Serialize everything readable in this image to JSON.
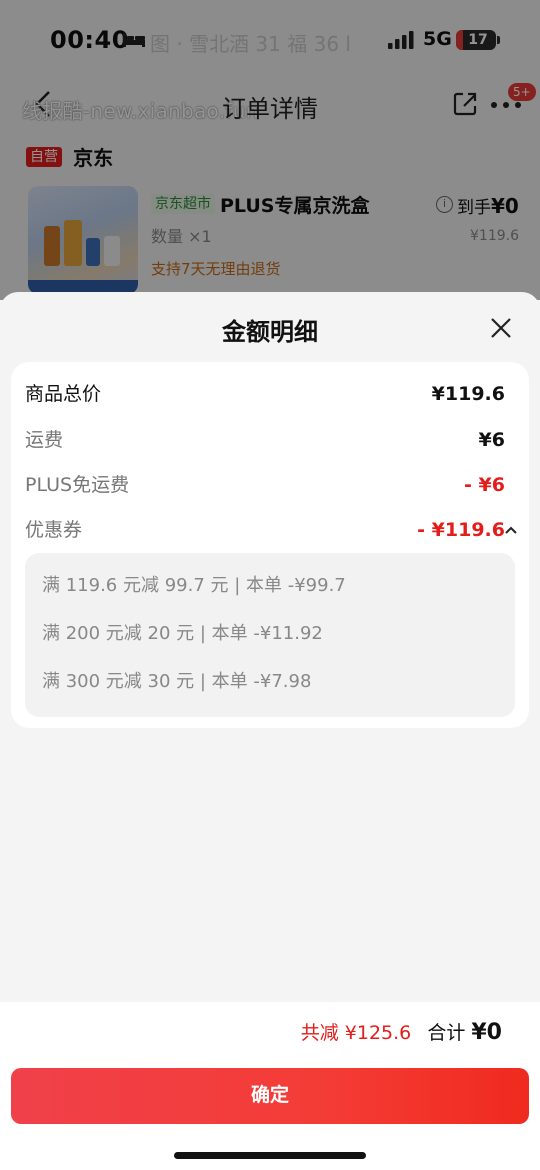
{
  "status_bar": {
    "time": "00:40",
    "faded_text": "图 · 雪北酒 31 福 36 l",
    "network": "5G",
    "battery": "17"
  },
  "nav": {
    "watermark": "线报酷-new.xianbao.fun",
    "title": "订单详情",
    "badge": "5+"
  },
  "store": {
    "tag": "自营",
    "name": "京东"
  },
  "product": {
    "market_tag": "京东超市",
    "title": "PLUS专属京洗盒",
    "quantity": "数量 ×1",
    "return_note": "支持7天无理由退货",
    "arrive_label": "到手",
    "arrive_price": "¥0",
    "original_price": "¥119.6"
  },
  "sheet": {
    "title": "金额明细",
    "rows": [
      {
        "label": "商品总价",
        "value": "¥119.6"
      },
      {
        "label": "运费",
        "value": "¥6"
      },
      {
        "label": "PLUS免运费",
        "value": "- ¥6"
      },
      {
        "label": "优惠券",
        "value": "- ¥119.6"
      }
    ],
    "coupons": [
      "满 119.6 元减 99.7 元 | 本单 -¥99.7",
      "满 200 元减 20 元 | 本单 -¥11.92",
      "满 300 元减 30 元 | 本单 -¥7.98"
    ]
  },
  "footer": {
    "saved": "共减 ¥125.6",
    "total_label": "合计",
    "total_amount": "¥0",
    "confirm": "确定"
  },
  "colors": {
    "accent_red": "#e31d1a",
    "button_red": "#f43c36",
    "market_green": "#2f8a3b",
    "note_orange": "#c56a17"
  }
}
